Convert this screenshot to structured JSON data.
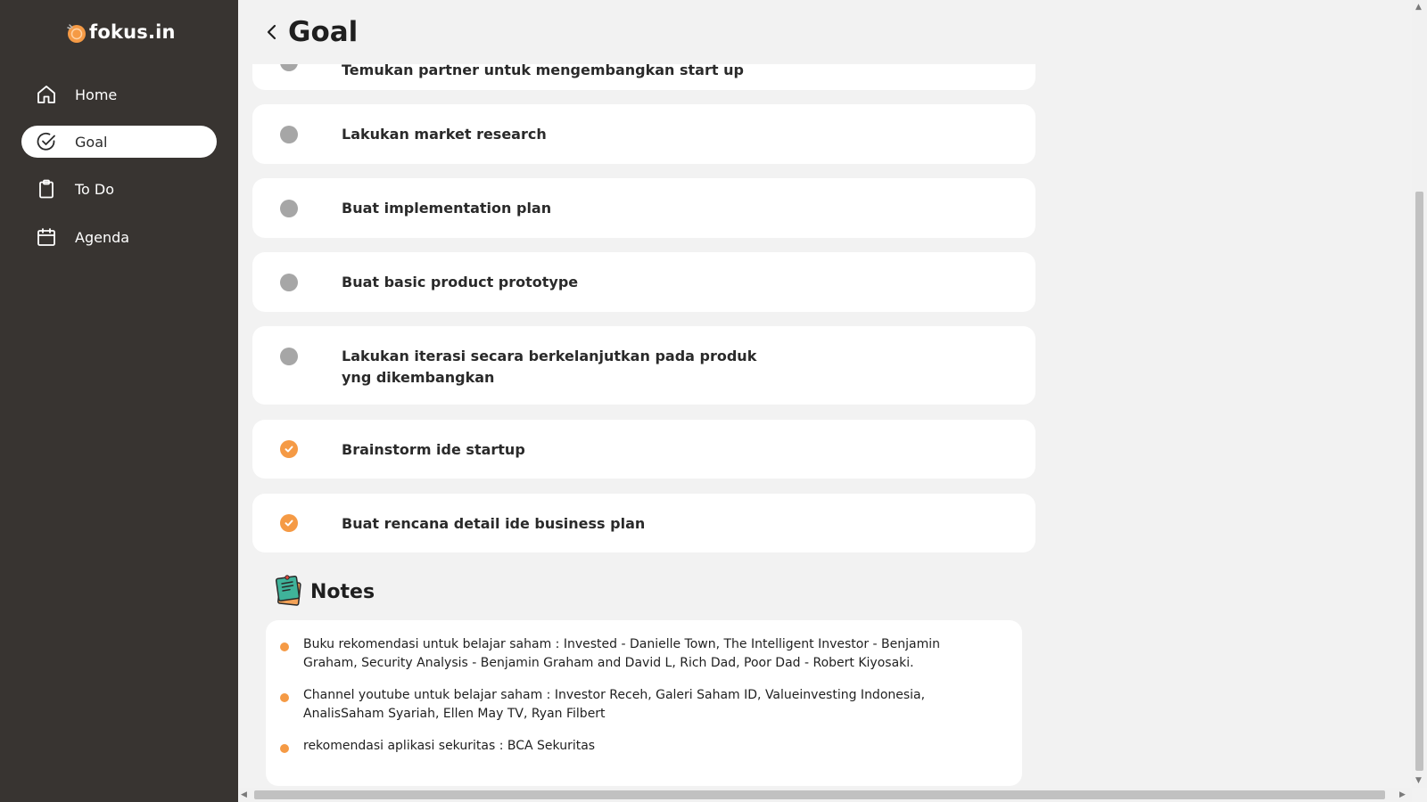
{
  "app": {
    "logo_text": "fokus.in",
    "brand_color": "#f59a45",
    "sidebar_color": "#383431"
  },
  "sidebar": {
    "items": [
      {
        "label": "Home",
        "icon": "home-icon",
        "active": false
      },
      {
        "label": "Goal",
        "icon": "check-circle-icon",
        "active": true
      },
      {
        "label": "To Do",
        "icon": "clipboard-icon",
        "active": false
      },
      {
        "label": "Agenda",
        "icon": "calendar-icon",
        "active": false
      }
    ]
  },
  "header": {
    "title": "Goal",
    "back_icon": "chevron-left-icon"
  },
  "tasks": [
    {
      "text": "Temukan partner untuk mengembangkan start up",
      "done": false
    },
    {
      "text": "Lakukan market research",
      "done": false
    },
    {
      "text": "Buat implementation plan",
      "done": false
    },
    {
      "text": "Buat basic product prototype",
      "done": false
    },
    {
      "text": "Lakukan iterasi secara berkelanjutkan pada produk yng dikembangkan",
      "done": false
    },
    {
      "text": "Brainstorm ide startup",
      "done": true
    },
    {
      "text": "Buat rencana detail ide business plan",
      "done": true
    }
  ],
  "notes": {
    "title": "Notes",
    "icon": "notepad-icon",
    "items": [
      "Buku rekomendasi untuk belajar saham : Invested - Danielle Town, The Intelligent Investor - Benjamin Graham, Security Analysis - Benjamin Graham and David L, Rich Dad, Poor Dad - Robert Kiyosaki.",
      "Channel youtube untuk belajar saham : Investor Receh, Galeri Saham ID, Valueinvesting Indonesia, AnalisSaham Syariah, Ellen May TV, Ryan Filbert",
      "rekomendasi aplikasi sekuritas : BCA Sekuritas"
    ]
  },
  "scroll": {
    "vertical_position": "bottom",
    "horizontal_position": "left"
  }
}
